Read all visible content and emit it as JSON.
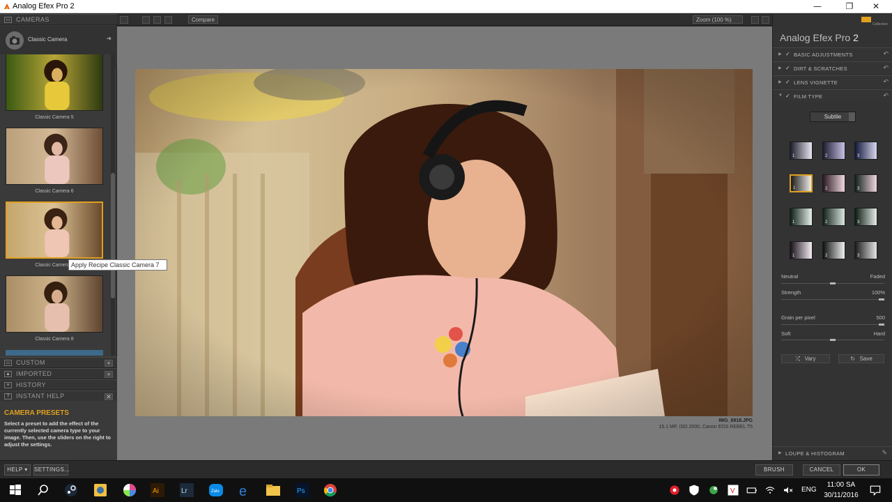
{
  "window": {
    "title": "Analog Efex Pro 2",
    "controls": [
      "—",
      "❐",
      "✕"
    ]
  },
  "left_panel": {
    "cameras_header": "CAMERAS",
    "selected_camera": "Classic Camera",
    "presets": [
      {
        "label": "Classic Camera 5",
        "selected": false
      },
      {
        "label": "Classic Camera 6",
        "selected": false
      },
      {
        "label": "Classic Camera 7",
        "selected": true
      },
      {
        "label": "Classic Camera 8",
        "selected": false
      }
    ],
    "sections": {
      "custom": "CUSTOM",
      "imported": "IMPORTED",
      "history": "HISTORY",
      "instant_help": "INSTANT HELP"
    },
    "help_title": "CAMERA PRESETS",
    "help_text": "Select a preset to add the effect of the currently selected camera type to your image. Then, use the sliders on the right to adjust the settings."
  },
  "tooltip": "Apply Recipe Classic Camera 7",
  "toolbar": {
    "compare_label": "Compare",
    "zoom_label": "Zoom (100 %)"
  },
  "canvas": {
    "filename": "IMG_6918.JPG",
    "file_info": "15.1 MP, ISO 2000, Canon EOS REBEL T5"
  },
  "right_panel": {
    "brand_name": "Analog Efex Pro",
    "brand_version": "2",
    "collection_label": "Collection",
    "sections": [
      {
        "label": "BASIC ADJUSTMENTS",
        "expanded": false
      },
      {
        "label": "DIRT & SCRATCHES",
        "expanded": false
      },
      {
        "label": "LENS VIGNETTE",
        "expanded": false
      },
      {
        "label": "FILM TYPE",
        "expanded": true
      }
    ],
    "film_type_dropdown": "Subtile",
    "film_numbers": [
      "1",
      "2",
      "3",
      "1",
      "2",
      "3",
      "1",
      "2",
      "3",
      "1",
      "2",
      "3"
    ],
    "selected_film": 4,
    "slider_neutral": "Neutral",
    "slider_faded": "Faded",
    "strength_label": "Strength",
    "strength_value": "100%",
    "grain_label": "Grain per pixel",
    "grain_value": "500",
    "soft_label": "Soft",
    "hard_label": "Hard",
    "vary_label": "Vary",
    "save_label": "Save",
    "loupe_label": "LOUPE & HISTOGRAM"
  },
  "bottom_bar": {
    "help": "HELP ▾",
    "settings": "SETTINGS...",
    "brush": "BRUSH",
    "cancel": "CANCEL",
    "ok": "OK"
  },
  "taskbar": {
    "language": "ENG",
    "time": "11:00 SA",
    "date": "30/11/2016"
  },
  "colors": {
    "accent": "#e0a020",
    "canvas_bg": "#7a7a7a",
    "panel_bg": "#3a3a3a"
  }
}
